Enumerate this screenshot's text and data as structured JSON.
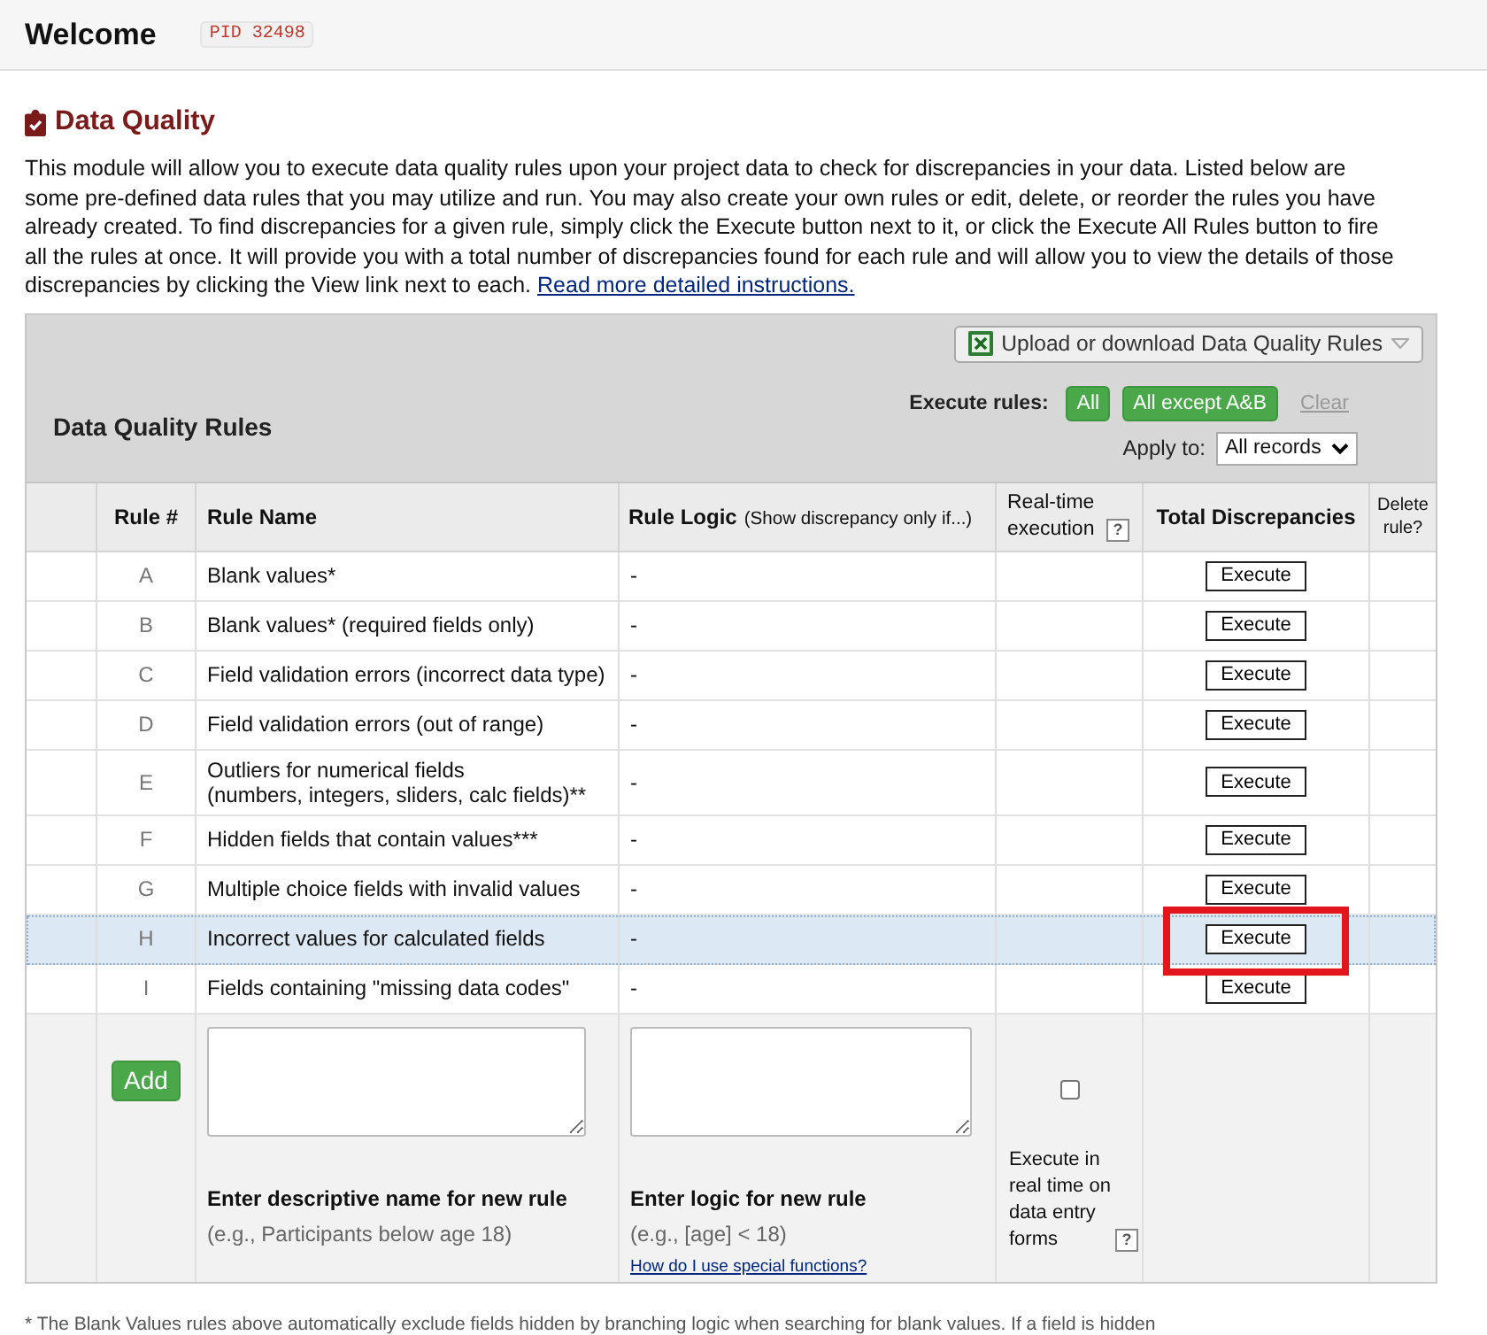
{
  "header": {
    "title": "Welcome",
    "pid": "PID 32498"
  },
  "section": {
    "title": "Data Quality",
    "intro": "This module will allow you to execute data quality rules upon your project data to check for discrepancies in your data. Listed below are some pre-defined data rules that you may utilize and run. You may also create your own rules or edit, delete, or reorder the rules you have already created. To find discrepancies for a given rule, simply click the Execute button next to it, or click the Execute All Rules button to fire all the rules at once. It will provide you with a total number of discrepancies found for each rule and will allow you to view the details of those discrepancies by clicking the View link next to each.",
    "intro_link": "Read more detailed instructions."
  },
  "panel": {
    "title": "Data Quality Rules",
    "upload_button": "Upload or download Data Quality Rules",
    "execute_label": "Execute rules:",
    "execute_buttons": [
      "All",
      "All except A&B"
    ],
    "clear": {
      "label": "Clear",
      "disabled": true
    },
    "apply_label": "Apply to:",
    "apply_value": "All records"
  },
  "table": {
    "columns": [
      {
        "label": "Rule #"
      },
      {
        "label": "Rule Name"
      },
      {
        "label": "Rule Logic",
        "note": "(Show discrepancy only if...)"
      },
      {
        "label": "Real-time execution",
        "help": "?"
      },
      {
        "label": "Total Discrepancies"
      },
      {
        "label": "Delete rule?"
      }
    ],
    "rows": [
      {
        "rule": "A",
        "name": "Blank values*",
        "logic": "-",
        "action": "Execute",
        "selected": false,
        "callout": false
      },
      {
        "rule": "B",
        "name": "Blank values* (required fields only)",
        "logic": "-",
        "action": "Execute",
        "selected": false,
        "callout": false
      },
      {
        "rule": "C",
        "name": "Field validation errors (incorrect data type)",
        "logic": "-",
        "action": "Execute",
        "selected": false,
        "callout": false
      },
      {
        "rule": "D",
        "name": "Field validation errors (out of range)",
        "logic": "-",
        "action": "Execute",
        "selected": false,
        "callout": false
      },
      {
        "rule": "E",
        "name": "Outliers for numerical fields\n(numbers, integers, sliders, calc fields)**",
        "logic": "-",
        "action": "Execute",
        "selected": false,
        "callout": false
      },
      {
        "rule": "F",
        "name": "Hidden fields that contain values***",
        "logic": "-",
        "action": "Execute",
        "selected": false,
        "callout": false
      },
      {
        "rule": "G",
        "name": "Multiple choice fields with invalid values",
        "logic": "-",
        "action": "Execute",
        "selected": false,
        "callout": false
      },
      {
        "rule": "H",
        "name": "Incorrect values for calculated fields",
        "logic": "-",
        "action": "Execute",
        "selected": true,
        "callout": true
      },
      {
        "rule": "I",
        "name": "Fields containing \"missing data codes\"",
        "logic": "-",
        "action": "Execute",
        "selected": false,
        "callout": false
      }
    ]
  },
  "new_rule": {
    "add_button": "Add",
    "name_label": "Enter descriptive name for new rule",
    "name_hint": "(e.g., Participants below age 18)",
    "logic_label": "Enter logic for new rule",
    "logic_hint": "(e.g., [age] < 18)",
    "logic_link": "How do I use special functions?",
    "realtime_checked": false,
    "realtime_label": "Execute in real time on data entry forms",
    "realtime_help": "?"
  },
  "footnote": "* The Blank Values rules above automatically exclude fields hidden by branching logic when searching for blank values. If a field is hidden"
}
